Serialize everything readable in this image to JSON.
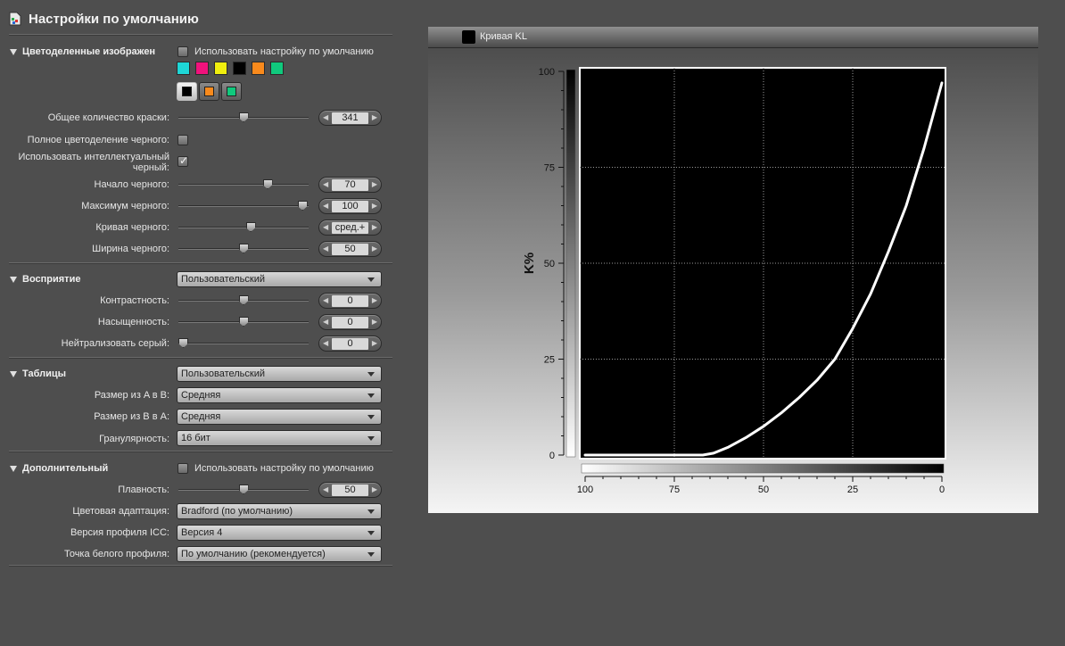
{
  "header": {
    "title": "Настройки по умолчанию",
    "icon": "settings-document-icon"
  },
  "separations": {
    "title": "Цветоделенные изображен",
    "use_default_label": "Использовать настройку по умолчанию",
    "use_default_checked": false,
    "ink_colors": [
      "#1ed6d6",
      "#f0127c",
      "#f0ee0e",
      "#000000",
      "#f98a1c",
      "#10c97d"
    ],
    "ink_buttons": [
      {
        "color": "#000000",
        "selected": true
      },
      {
        "color": "#f98a1c",
        "selected": false
      },
      {
        "color": "#10c97d",
        "selected": false
      }
    ],
    "total_ink": {
      "label": "Общее количество краски:",
      "value": "341",
      "level": 0.5
    },
    "full_black": {
      "label": "Полное цветоделение черного:",
      "checked": false
    },
    "smart_black": {
      "label_line1": "Использовать интеллектуальный",
      "label_line2": "черный:",
      "checked": true
    },
    "black_start": {
      "label": "Начало черного:",
      "value": "70",
      "level": 0.7
    },
    "black_max": {
      "label": "Максимум черного:",
      "value": "100",
      "level": 0.99
    },
    "black_curve": {
      "label": "Кривая черного:",
      "value": "сред.+",
      "level": 0.56
    },
    "black_width": {
      "label": "Ширина черного:",
      "value": "50",
      "level": 0.5
    }
  },
  "perception": {
    "title": "Восприятие",
    "preset": "Пользовательский",
    "contrast": {
      "label": "Контрастность:",
      "value": "0",
      "level": 0.5
    },
    "saturation": {
      "label": "Насыщенность:",
      "value": "0",
      "level": 0.5
    },
    "neutral_gray": {
      "label": "Нейтрализовать серый:",
      "value": "0",
      "level": 0.0
    }
  },
  "tables": {
    "title": "Таблицы",
    "preset": "Пользовательский",
    "a2b": {
      "label": "Размер из A в B:",
      "value": "Средняя"
    },
    "b2a": {
      "label": "Размер из B в A:",
      "value": "Средняя"
    },
    "granularity": {
      "label": "Гранулярность:",
      "value": "16 бит"
    }
  },
  "advanced": {
    "title": "Дополнительный",
    "use_default_label": "Использовать настройку по умолчанию",
    "use_default_checked": false,
    "smoothness": {
      "label": "Плавность:",
      "value": "50",
      "level": 0.5
    },
    "adaptation": {
      "label": "Цветовая адаптация:",
      "value": "Bradford (по умолчанию)"
    },
    "icc_version": {
      "label": "Версия профиля ICC:",
      "value": "Версия 4"
    },
    "white_point": {
      "label": "Точка белого профиля:",
      "value": "По умолчанию (рекомендуется)"
    }
  },
  "chart_panel": {
    "title": "Кривая KL"
  },
  "chart_data": {
    "type": "line",
    "ylabel": "K%",
    "xlabel": "",
    "xlim": [
      100,
      0
    ],
    "ylim": [
      0,
      100
    ],
    "x_ticks": [
      "100",
      "75",
      "50",
      "25",
      "0"
    ],
    "y_ticks": [
      "100",
      "75",
      "50",
      "25",
      "0"
    ],
    "grid": true,
    "series": [
      {
        "x": [
          100,
          95,
          90,
          85,
          80,
          75,
          70,
          67,
          64,
          60,
          55,
          50,
          45,
          40,
          35,
          30,
          25,
          20,
          15,
          10,
          5,
          0
        ],
        "y": [
          0,
          0,
          0,
          0,
          0,
          0,
          0,
          0,
          0.5,
          2,
          4.5,
          7.5,
          11,
          15,
          19.5,
          25,
          33,
          42,
          53,
          65,
          80,
          97
        ]
      }
    ]
  }
}
